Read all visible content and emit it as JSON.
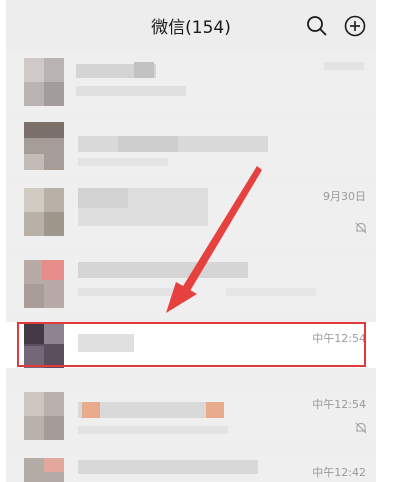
{
  "header": {
    "title": "微信(154)",
    "search_icon": "search-icon",
    "add_icon": "plus-circle-icon"
  },
  "chats": [
    {
      "time": "9月30日",
      "muted": true
    },
    {
      "time": "中午12:54",
      "muted": false
    },
    {
      "time": "中午12:54",
      "muted": true
    },
    {
      "time": "中午12:42",
      "muted": false
    }
  ],
  "colors": {
    "highlight": "#e2393b",
    "arrow": "#e6413f"
  }
}
